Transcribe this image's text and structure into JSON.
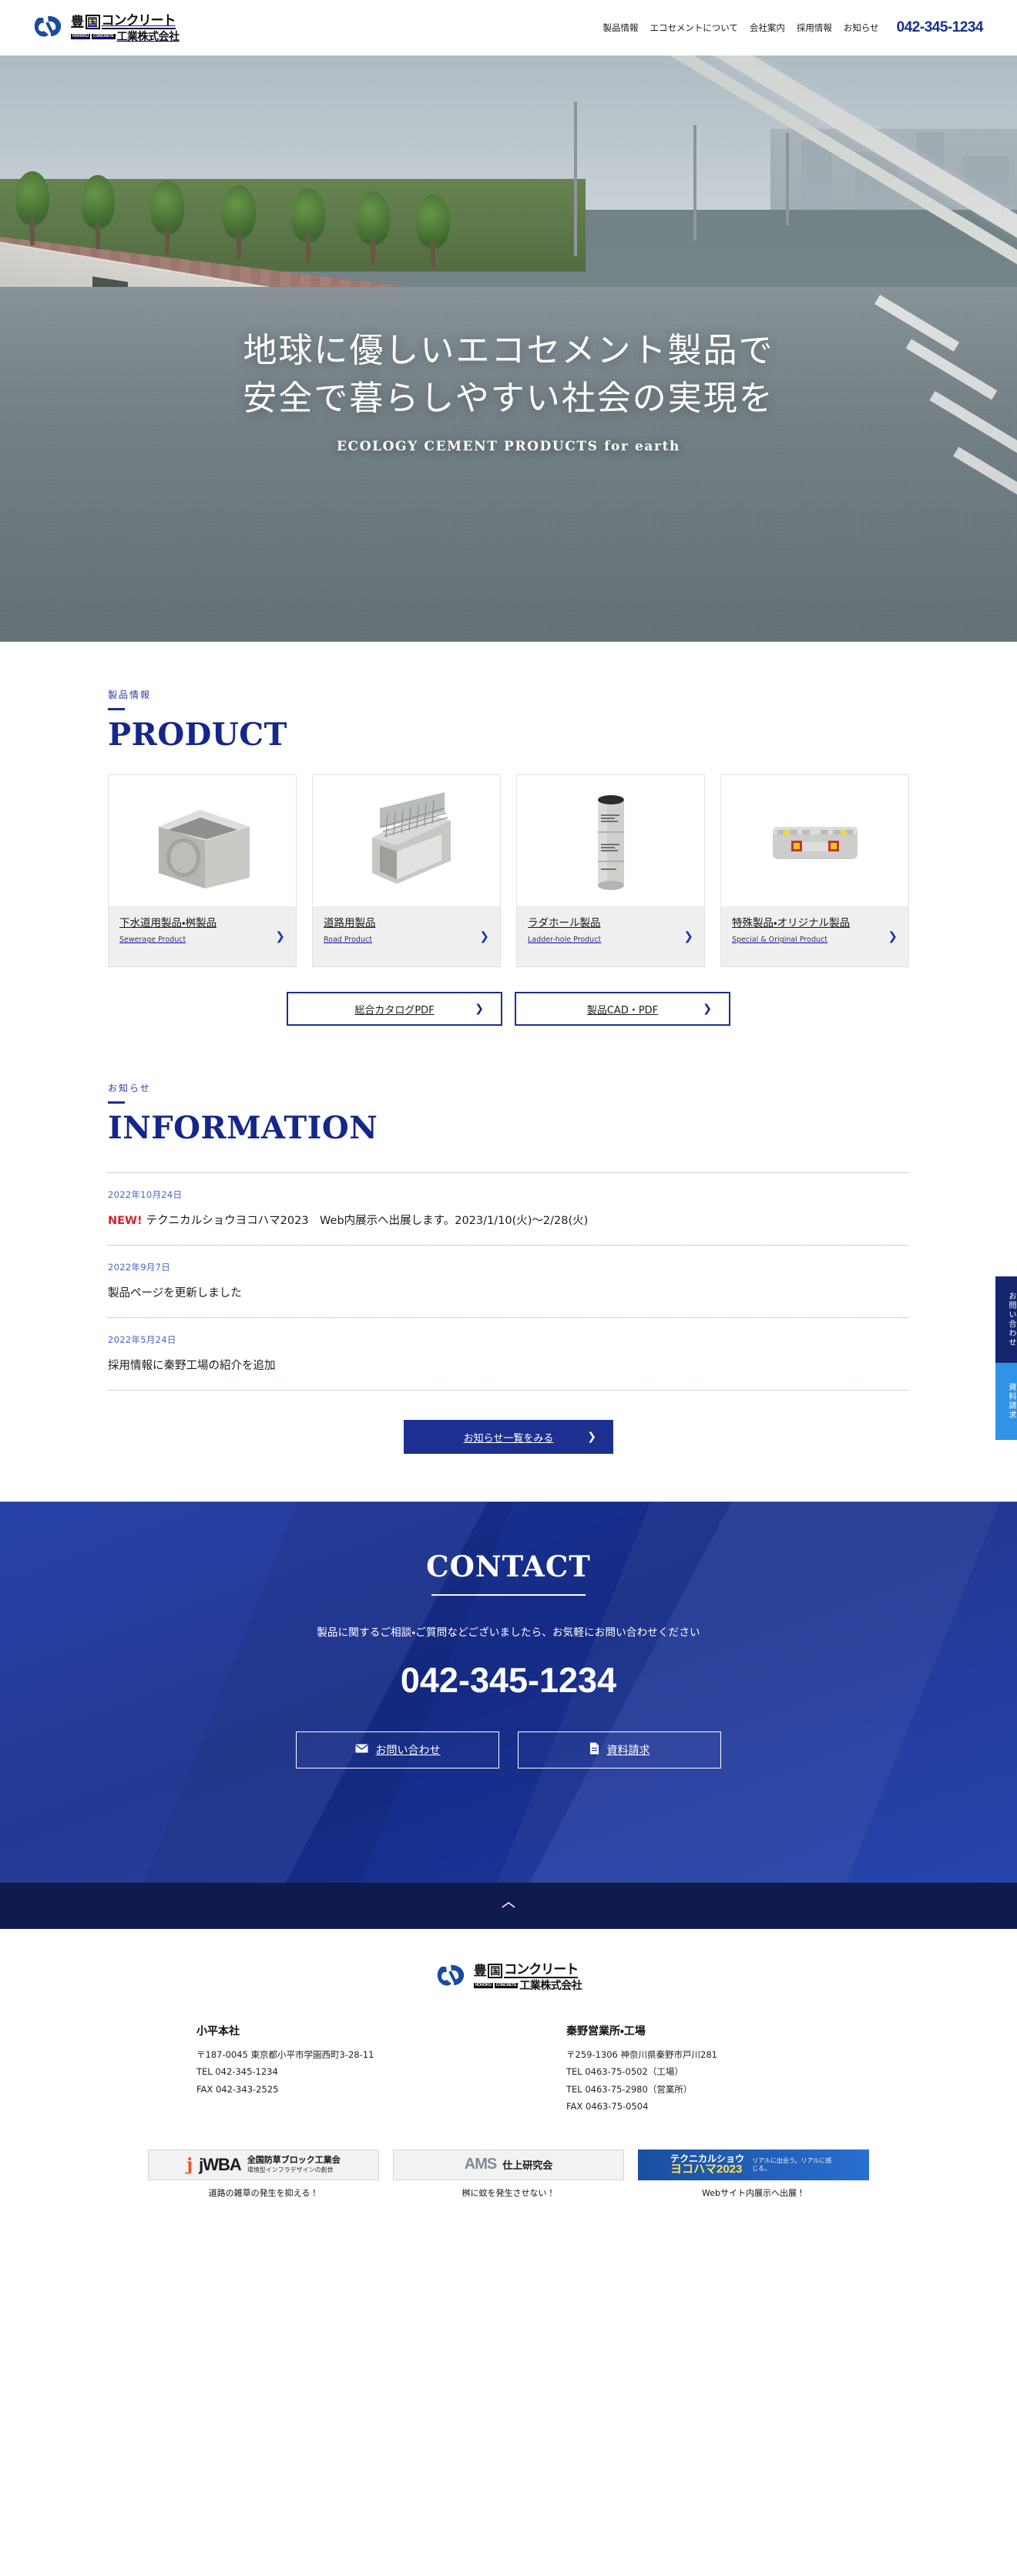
{
  "meta": {
    "accent_blue": "#1d2f8f",
    "accent_light": "#4a63c4",
    "red": "#d8232a"
  },
  "header": {
    "logo": {
      "kanji": "豊",
      "boxed": "国",
      "katakana": "コンクリート",
      "sub": "工業株式会社",
      "romaji_1": "HOHOKU",
      "romaji_2": "CONCRETE",
      "alt": "豊国コンクリート工業株式会社"
    },
    "nav": [
      {
        "label": "製品情報"
      },
      {
        "label": "エコセメントについて"
      },
      {
        "label": "会社案内"
      },
      {
        "label": "採用情報"
      },
      {
        "label": "お知らせ"
      }
    ],
    "tel": "042-345-1234"
  },
  "hero": {
    "line1": "地球に優しいエコセメント製品で",
    "line2": "安全で暮らしやすい社会の実現を",
    "en": "ECOLOGY CEMENT PRODUCTS for earth"
  },
  "product": {
    "ja": "製品情報",
    "en": "PRODUCT",
    "cards": [
      {
        "ja": "下水道用製品・桝製品",
        "en": "Sewerage Product",
        "arrow": "❯",
        "icon": "sewer-box-icon"
      },
      {
        "ja": "道路用製品",
        "en": "Road Product",
        "arrow": "❯",
        "icon": "road-gutter-icon"
      },
      {
        "ja": "ラダホール製品",
        "en": "Ladder-hole Product",
        "arrow": "❯",
        "icon": "ladder-hole-icon"
      },
      {
        "ja": "特殊製品・オリジナル製品",
        "en": "Special & Original Product",
        "arrow": "❯",
        "icon": "special-block-icon"
      }
    ],
    "buttons": [
      {
        "label": "総合カタログPDF",
        "arrow": "❯"
      },
      {
        "label": "製品CAD・PDF",
        "arrow": "❯"
      }
    ]
  },
  "information": {
    "ja": "お知らせ",
    "en": "INFORMATION",
    "items": [
      {
        "date": "2022年10月24日",
        "badge": "NEW!",
        "title": "テクニカルショウヨコハマ2023　Web内展示へ出展します。2023/1/10(火)〜2/28(火)"
      },
      {
        "date": "2022年9月7日",
        "badge": "",
        "title": "製品ページを更新しました"
      },
      {
        "date": "2022年5月24日",
        "badge": "",
        "title": "採用情報に秦野工場の紹介を追加"
      }
    ],
    "all_button": {
      "label": "お知らせ一覧をみる",
      "arrow": "❯"
    }
  },
  "contact": {
    "title": "CONTACT",
    "lead": "製品に関するご相談・ご質問などございましたら、お気軽にお問い合わせください",
    "tel": "042-345-1234",
    "buttons": [
      {
        "label": "お問い合わせ",
        "icon": "mail-icon"
      },
      {
        "label": "資料請求",
        "icon": "document-icon"
      }
    ]
  },
  "to_top": {
    "caret": "^"
  },
  "footer": {
    "logo": {
      "kanji": "豊",
      "boxed": "国",
      "katakana": "コンクリート",
      "sub": "工業株式会社",
      "romaji_1": "HOHOKU",
      "romaji_2": "CONCRETE"
    },
    "offices": [
      {
        "name": "小平本社",
        "address": "〒187-0045 東京都小平市学園西町3-28-11",
        "lines": [
          "TEL 042-345-1234",
          "FAX 042-343-2525"
        ]
      },
      {
        "name": "秦野営業所・工場",
        "address": "〒259-1306 神奈川県秦野市戸川281",
        "lines": [
          "TEL 0463-75-0502（工場）",
          "TEL 0463-75-2980（営業所）",
          "FAX 0463-75-0504"
        ]
      }
    ],
    "banners": [
      {
        "logo_mark": "jWBA",
        "title": "全国防草ブロック工業会",
        "subtitle": "環境型インフラデザインの創世",
        "caption": "道路の雑草の発生を抑える！"
      },
      {
        "logo_mark": "AMS",
        "title": "仕上研究会",
        "subtitle": "",
        "caption": "桝に蚊を発生させない！"
      },
      {
        "logo_mark": "テクニカルショウ",
        "title": "ヨコハマ2023",
        "subtitle": "リアルに出会う。リアルに感じる。",
        "caption": "Webサイト内展示へ出展！"
      }
    ]
  },
  "side_tabs": [
    {
      "label": "お問い合わせ",
      "style": "dark"
    },
    {
      "label": "資料請求",
      "style": "light"
    }
  ]
}
